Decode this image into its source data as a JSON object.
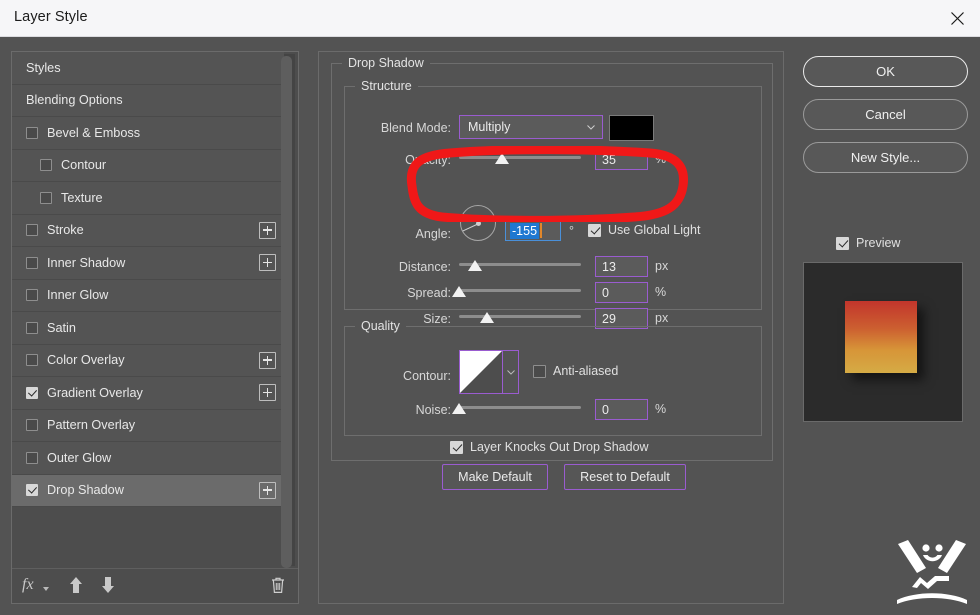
{
  "window": {
    "title": "Layer Style",
    "close_icon": "close-icon"
  },
  "sidebar": {
    "items": [
      {
        "label": "Styles",
        "type": "plain",
        "checked": false,
        "has_plus": false,
        "selected": false,
        "indent": false
      },
      {
        "label": "Blending Options",
        "type": "plain",
        "checked": false,
        "has_plus": false,
        "selected": false,
        "indent": false
      },
      {
        "label": "Bevel & Emboss",
        "type": "check",
        "checked": false,
        "has_plus": false,
        "selected": false,
        "indent": false
      },
      {
        "label": "Contour",
        "type": "check",
        "checked": false,
        "has_plus": false,
        "selected": false,
        "indent": true
      },
      {
        "label": "Texture",
        "type": "check",
        "checked": false,
        "has_plus": false,
        "selected": false,
        "indent": true
      },
      {
        "label": "Stroke",
        "type": "check",
        "checked": false,
        "has_plus": true,
        "selected": false,
        "indent": false
      },
      {
        "label": "Inner Shadow",
        "type": "check",
        "checked": false,
        "has_plus": true,
        "selected": false,
        "indent": false
      },
      {
        "label": "Inner Glow",
        "type": "check",
        "checked": false,
        "has_plus": false,
        "selected": false,
        "indent": false
      },
      {
        "label": "Satin",
        "type": "check",
        "checked": false,
        "has_plus": false,
        "selected": false,
        "indent": false
      },
      {
        "label": "Color Overlay",
        "type": "check",
        "checked": false,
        "has_plus": true,
        "selected": false,
        "indent": false
      },
      {
        "label": "Gradient Overlay",
        "type": "check",
        "checked": true,
        "has_plus": true,
        "selected": false,
        "indent": false
      },
      {
        "label": "Pattern Overlay",
        "type": "check",
        "checked": false,
        "has_plus": false,
        "selected": false,
        "indent": false
      },
      {
        "label": "Outer Glow",
        "type": "check",
        "checked": false,
        "has_plus": false,
        "selected": false,
        "indent": false
      },
      {
        "label": "Drop Shadow",
        "type": "check",
        "checked": true,
        "has_plus": true,
        "selected": true,
        "indent": false
      }
    ],
    "toolbar": {
      "fx_label": "fx",
      "fx_icon": "fx-menu-icon",
      "move_up_icon": "arrow-up-icon",
      "move_down_icon": "arrow-down-icon",
      "delete_icon": "trash-icon"
    }
  },
  "panel": {
    "title": "Drop Shadow",
    "structure": {
      "legend": "Structure",
      "blend_mode_label": "Blend Mode:",
      "blend_mode_value": "Multiply",
      "color_swatch": "#000000",
      "opacity_label": "Opacity:",
      "opacity_value": "35",
      "opacity_unit": "%",
      "opacity_percent": 35,
      "angle_label": "Angle:",
      "angle_value": "-155",
      "angle_unit": "°",
      "use_global_light_label": "Use Global Light",
      "use_global_light_checked": true,
      "distance_label": "Distance:",
      "distance_value": "13",
      "distance_unit": "px",
      "distance_percent": 13,
      "spread_label": "Spread:",
      "spread_value": "0",
      "spread_unit": "%",
      "spread_percent": 0,
      "size_label": "Size:",
      "size_value": "29",
      "size_unit": "px",
      "size_percent": 23
    },
    "quality": {
      "legend": "Quality",
      "contour_label": "Contour:",
      "anti_aliased_label": "Anti-aliased",
      "anti_aliased_checked": false,
      "noise_label": "Noise:",
      "noise_value": "0",
      "noise_unit": "%",
      "noise_percent": 0
    },
    "knockout_label": "Layer Knocks Out Drop Shadow",
    "knockout_checked": true,
    "make_default_label": "Make Default",
    "reset_default_label": "Reset to Default"
  },
  "actions": {
    "ok_label": "OK",
    "cancel_label": "Cancel",
    "new_style_label": "New Style...",
    "preview_label": "Preview",
    "preview_checked": true
  },
  "colors": {
    "accent_purple": "#9a5cd0",
    "selection_blue": "#1f78d1",
    "annotation_red": "#f01818",
    "panel_bg": "#535353",
    "row_selected": "#6b6b6b"
  }
}
